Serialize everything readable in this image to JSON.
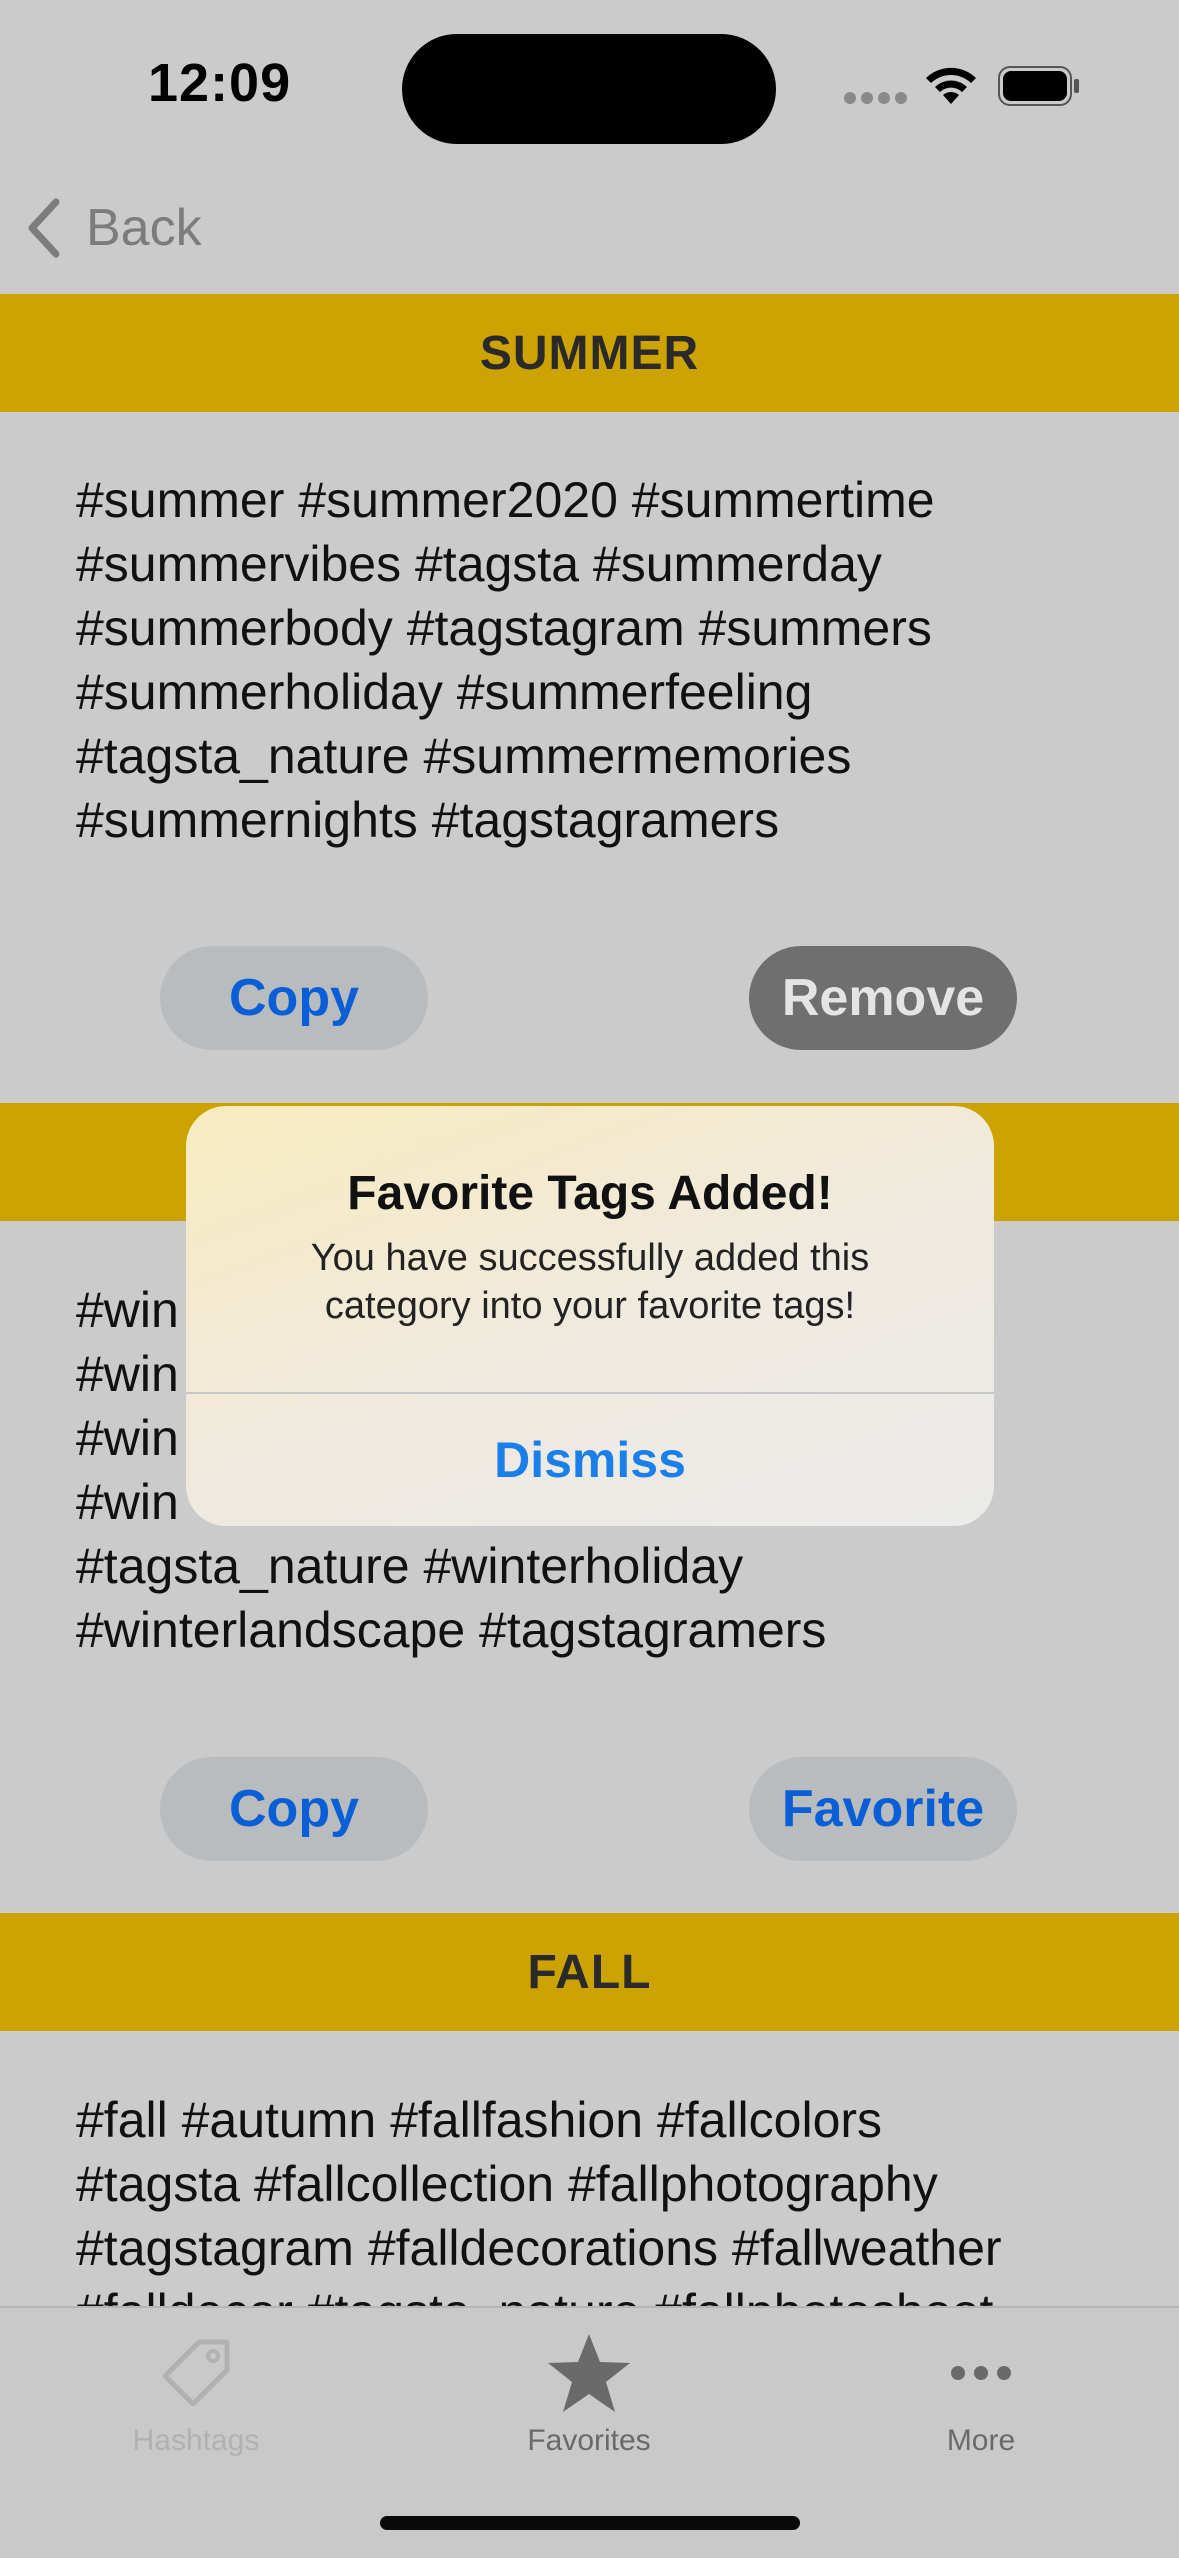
{
  "status": {
    "time": "12:09"
  },
  "nav": {
    "back_label": "Back"
  },
  "sections": [
    {
      "title": "SUMMER",
      "tags": "#summer #summer2020 #summertime\n#summervibes  #tagsta #summerday\n#summerbody #tagstagram #summers\n#summerholiday #summerfeeling\n#tagsta_nature #summermemories\n#summernights #tagstagramers",
      "copy_label": "Copy",
      "action_label": "Remove"
    },
    {
      "title": "",
      "tags": "#win\n#win\n#win                                                                    am\n#win\n#tagsta_nature #winterholiday\n#winterlandscape #tagstagramers",
      "copy_label": "Copy",
      "action_label": "Favorite"
    },
    {
      "title": "FALL",
      "tags": "#fall #autumn #fallfashion #fallcolors\n#tagsta #fallcollection #fallphotography\n#tagstagram #falldecorations #fallweather\n#falldecor #tagsta_nature #fallphotoshoot"
    }
  ],
  "alert": {
    "title": "Favorite Tags Added!",
    "message": "You have successfully added this category into your favorite tags!",
    "button_label": "Dismiss"
  },
  "tabbar": {
    "items": [
      {
        "label": "Hashtags",
        "icon": "tag-icon"
      },
      {
        "label": "Favorites",
        "icon": "star-icon"
      },
      {
        "label": "More",
        "icon": "ellipsis-icon"
      }
    ]
  },
  "colors": {
    "accent_band": "#cca300",
    "link_blue": "#0b5fd6",
    "alert_blue": "#1a7fe8",
    "background": "#cbcbcb"
  }
}
